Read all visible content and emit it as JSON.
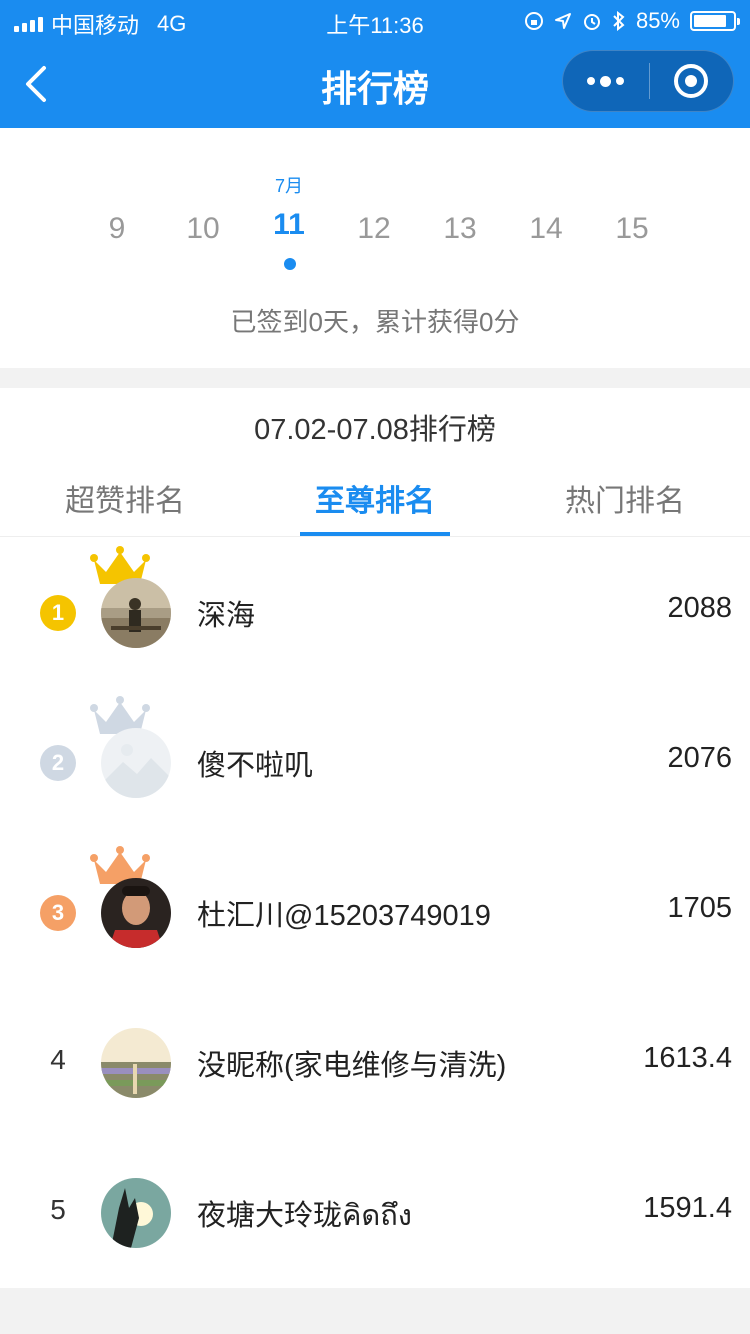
{
  "status": {
    "carrier": "中国移动",
    "network": "4G",
    "time": "上午11:36",
    "battery": "85%",
    "battery_level": 0.85
  },
  "nav": {
    "title": "排行榜",
    "back_icon": "chevron-left-icon",
    "more_icon": "more-dots-icon",
    "close_icon": "target-icon"
  },
  "calendar": {
    "month": "7月",
    "days": [
      "9",
      "10",
      "11",
      "12",
      "13",
      "14",
      "15"
    ],
    "selected_day": "11",
    "signin_text": "已签到0天，累计获得0分"
  },
  "ranking": {
    "range_title": "07.02-07.08排行榜",
    "tabs": [
      "超赞排名",
      "至尊排名",
      "热门排名"
    ],
    "active_tab": "至尊排名",
    "badge_colors": {
      "1": "#f5c400",
      "2": "#cfd8e3",
      "3": "#f5a066"
    },
    "rows": [
      {
        "rank": "1",
        "name": "深海",
        "score": "2088"
      },
      {
        "rank": "2",
        "name": "傻不啦叽",
        "score": "2076"
      },
      {
        "rank": "3",
        "name": "杜汇川@15203749019",
        "score": "1705"
      },
      {
        "rank": "4",
        "name": "没昵称(家电维修与清洗)",
        "score": "1613.4"
      },
      {
        "rank": "5",
        "name": "夜塘大玲珑คิดถึง",
        "score": "1591.4"
      }
    ]
  },
  "colors": {
    "primary": "#1a8cf0",
    "text_secondary": "#777777"
  }
}
